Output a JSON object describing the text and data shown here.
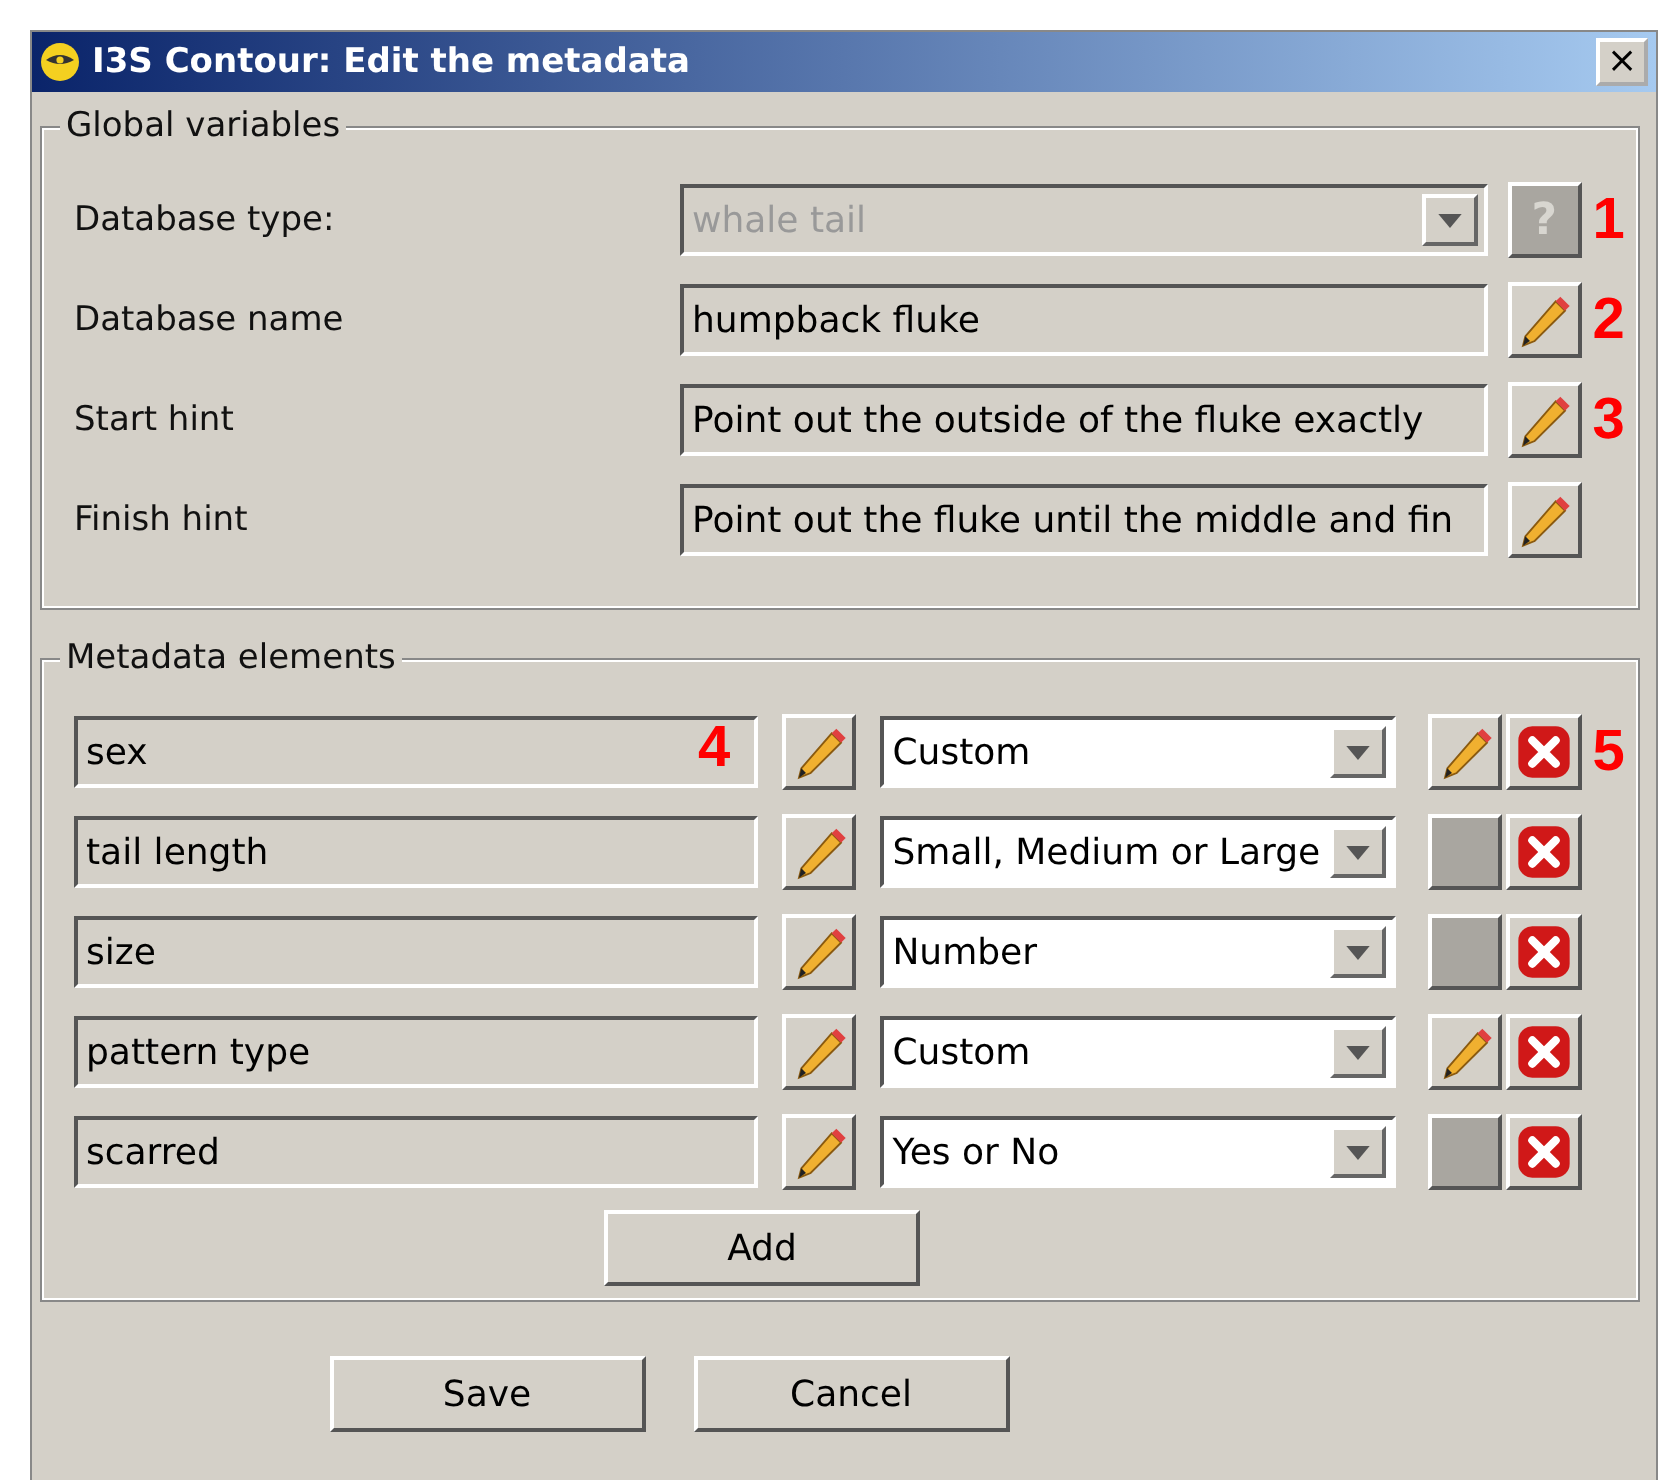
{
  "window": {
    "title": "I3S Contour: Edit the metadata",
    "close": "×"
  },
  "global_variables": {
    "title": "Global variables",
    "rows": [
      {
        "kind": "combo",
        "label": "Database type:",
        "value": "whale tail",
        "disabled": true,
        "button": {
          "kind": "help",
          "label": "?"
        },
        "annotation": "1"
      },
      {
        "kind": "text",
        "label": "Database name",
        "value": "humpback fluke",
        "disabled": false,
        "button": {
          "kind": "edit"
        },
        "annotation": "2"
      },
      {
        "kind": "text",
        "label": "Start hint",
        "value": "Point out the outside of the fluke exactly",
        "disabled": false,
        "button": {
          "kind": "edit"
        },
        "annotation": "3"
      },
      {
        "kind": "text",
        "label": "Finish hint",
        "value": "Point out the fluke until the middle and fin",
        "disabled": false,
        "button": {
          "kind": "edit"
        }
      }
    ]
  },
  "metadata_elements": {
    "title": "Metadata elements",
    "rows": [
      {
        "name": "sex",
        "type": "Custom",
        "type_edit_enabled": true,
        "name_annotation": "4",
        "annotation": "5"
      },
      {
        "name": "tail length",
        "type": "Small, Medium or Large",
        "type_edit_enabled": false
      },
      {
        "name": "size",
        "type": "Number",
        "type_edit_enabled": false
      },
      {
        "name": "pattern type",
        "type": "Custom",
        "type_edit_enabled": true
      },
      {
        "name": "scarred",
        "type": "Yes or No",
        "type_edit_enabled": false
      }
    ],
    "add": "Add"
  },
  "buttons": [
    "Save",
    "Cancel"
  ]
}
